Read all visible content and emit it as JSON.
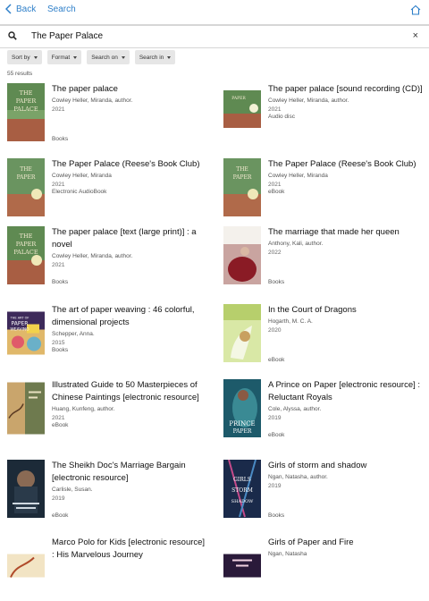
{
  "nav": {
    "back_label": "Back",
    "search_label": "Search"
  },
  "search": {
    "query": "The Paper Palace",
    "clear": "×"
  },
  "filters": [
    "Sort by",
    "Format",
    "Search on",
    "Search in"
  ],
  "results_count": "55 results",
  "results": [
    {
      "title": "The paper palace",
      "author": "Cowley Heller, Miranda, author.",
      "year": "2021",
      "format": "Books"
    },
    {
      "title": "The paper palace [sound recording (CD)]",
      "author": "Cowley Heller, Miranda, author.",
      "year": "2021",
      "format": "Audio disc"
    },
    {
      "title": "The Paper Palace (Reese's Book Club)",
      "author": "Cowley Heller, Miranda",
      "year": "2021",
      "format": "Electronic AudioBook"
    },
    {
      "title": "The Paper Palace (Reese's Book Club)",
      "author": "Cowley Heller, Miranda",
      "year": "2021",
      "format": "eBook"
    },
    {
      "title": "The paper palace [text (large print)] : a novel",
      "author": "Cowley Heller, Miranda, author.",
      "year": "2021",
      "format": "Books"
    },
    {
      "title": "The marriage that made her queen",
      "author": "Anthony, Kali, author.",
      "year": "2022",
      "format": "Books"
    },
    {
      "title": "The art of paper weaving : 46 colorful, dimensional projects",
      "author": "Schepper, Anna.",
      "year": "2015",
      "format": "Books"
    },
    {
      "title": "In the Court of Dragons",
      "author": "Hogarth, M. C. A.",
      "year": "2020",
      "format": "eBook"
    },
    {
      "title": "Illustrated Guide to 50 Masterpieces of Chinese Paintings [electronic resource]",
      "author": "Huang, Kunfeng, author.",
      "year": "2021",
      "format": "eBook"
    },
    {
      "title": "A Prince on Paper [electronic resource] : Reluctant Royals",
      "author": "Cole, Alyssa, author.",
      "year": "2019",
      "format": "eBook"
    },
    {
      "title": "The Sheikh Doc's Marriage Bargain [electronic resource]",
      "author": "Carlisle, Susan.",
      "year": "2019",
      "format": "eBook"
    },
    {
      "title": "Girls of storm and shadow",
      "author": "Ngan, Natasha, author.",
      "year": "2019",
      "format": "Books"
    },
    {
      "title": "Marco Polo for Kids [electronic resource] : His Marvelous Journey",
      "author": "",
      "year": "",
      "format": ""
    },
    {
      "title": "Girls of Paper and Fire",
      "author": "Ngan, Natasha",
      "year": "",
      "format": ""
    }
  ],
  "cover_text": {
    "paper_palace": [
      "THE",
      "PAPER",
      "PALACE"
    ],
    "art_weaving": [
      "THE ART OF",
      "PAPER",
      "WEAVING"
    ],
    "prince": [
      "PRINCE",
      "PAPER"
    ],
    "girls_storm": [
      "GIRLS",
      "STORM",
      "SHADOW"
    ]
  },
  "colors": {
    "link": "#2e7fc9",
    "chip_bg": "#e6e6e6",
    "divider": "#d6d6d6"
  }
}
